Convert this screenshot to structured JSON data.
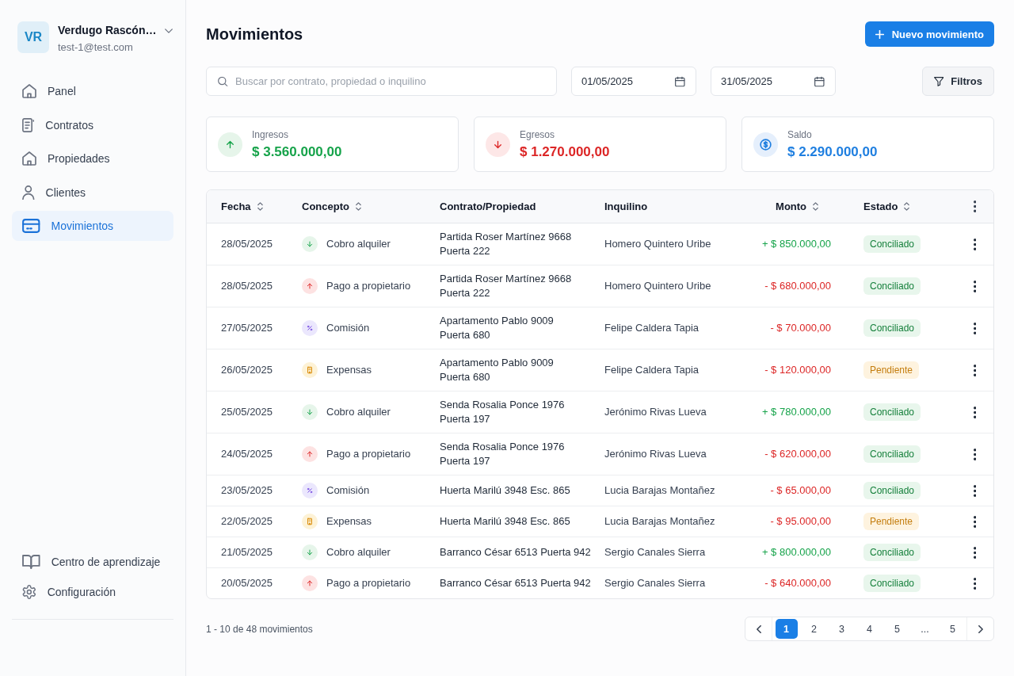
{
  "sidebar": {
    "user": {
      "initials": "VR",
      "name": "Verdugo Rascón…",
      "email": "test-1@test.com"
    },
    "nav_items": [
      {
        "label": "Panel",
        "selected": false
      },
      {
        "label": "Contratos",
        "selected": false
      },
      {
        "label": "Propiedades",
        "selected": false
      },
      {
        "label": "Clientes",
        "selected": false
      },
      {
        "label": "Movimientos",
        "selected": true
      }
    ],
    "footer_items": [
      {
        "label": "Centro de aprendizaje"
      },
      {
        "label": "Configuración"
      }
    ]
  },
  "header": {
    "title": "Movimientos",
    "primary_button": "Nuevo movimiento"
  },
  "filters": {
    "search": {
      "placeholder": "Buscar por contrato, propiedad o inquilino"
    },
    "date_from": {
      "value": "01/05/2025"
    },
    "date_to": {
      "value": "31/05/2025"
    },
    "filters_button": "Filtros"
  },
  "summary_cards": [
    {
      "kind": "income",
      "label": "Ingresos",
      "value": "$ 3.560.000,00"
    },
    {
      "kind": "expense",
      "label": "Egresos",
      "value": "$ 1.270.000,00"
    },
    {
      "kind": "balance",
      "label": "Saldo",
      "value": "$ 2.290.000,00"
    }
  ],
  "table": {
    "columns": [
      {
        "label": "Fecha",
        "sortable": true
      },
      {
        "label": "Concepto",
        "sortable": true
      },
      {
        "label": "Contrato/Propiedad",
        "sortable": false
      },
      {
        "label": "Inquilino",
        "sortable": false
      },
      {
        "label": "Monto",
        "sortable": true
      },
      {
        "label": "Estado",
        "sortable": true
      }
    ],
    "rows": [
      {
        "date": "28/05/2025",
        "concept": {
          "kind": "income",
          "label": "Cobro alquiler"
        },
        "property": "Partida Roser Martínez 9668\nPuerta 222",
        "tenant": "Homero Quintero Uribe",
        "amount": "+ $ 850.000,00",
        "status": {
          "kind": "reconciled",
          "label": "Conciliado"
        }
      },
      {
        "date": "28/05/2025",
        "concept": {
          "kind": "payout",
          "label": "Pago a propietario"
        },
        "property": "Partida Roser Martínez 9668\nPuerta 222",
        "tenant": "Homero Quintero Uribe",
        "amount": "- $ 680.000,00",
        "status": {
          "kind": "reconciled",
          "label": "Conciliado"
        }
      },
      {
        "date": "27/05/2025",
        "concept": {
          "kind": "commission",
          "label": "Comisión"
        },
        "property": "Apartamento Pablo 9009\nPuerta 680",
        "tenant": "Felipe Caldera Tapia",
        "amount": "- $ 70.000,00",
        "status": {
          "kind": "reconciled",
          "label": "Conciliado"
        }
      },
      {
        "date": "26/05/2025",
        "concept": {
          "kind": "expense",
          "label": "Expensas"
        },
        "property": "Apartamento Pablo 9009\nPuerta 680",
        "tenant": "Felipe Caldera Tapia",
        "amount": "- $ 120.000,00",
        "status": {
          "kind": "pending",
          "label": "Pendiente"
        }
      },
      {
        "date": "25/05/2025",
        "concept": {
          "kind": "income",
          "label": "Cobro alquiler"
        },
        "property": "Senda Rosalia Ponce 1976\nPuerta 197",
        "tenant": "Jerónimo Rivas Lueva",
        "amount": "+ $ 780.000,00",
        "status": {
          "kind": "reconciled",
          "label": "Conciliado"
        }
      },
      {
        "date": "24/05/2025",
        "concept": {
          "kind": "payout",
          "label": "Pago a propietario"
        },
        "property": "Senda Rosalia Ponce 1976\nPuerta 197",
        "tenant": "Jerónimo Rivas Lueva",
        "amount": "- $ 620.000,00",
        "status": {
          "kind": "reconciled",
          "label": "Conciliado"
        }
      },
      {
        "date": "23/05/2025",
        "concept": {
          "kind": "commission",
          "label": "Comisión"
        },
        "property": "Huerta Marilú 3948 Esc. 865",
        "tenant": "Lucia Barajas Montañez",
        "amount": "- $ 65.000,00",
        "status": {
          "kind": "reconciled",
          "label": "Conciliado"
        }
      },
      {
        "date": "22/05/2025",
        "concept": {
          "kind": "expense",
          "label": "Expensas"
        },
        "property": "Huerta Marilú 3948 Esc. 865",
        "tenant": "Lucia Barajas Montañez",
        "amount": "- $ 95.000,00",
        "status": {
          "kind": "pending",
          "label": "Pendiente"
        }
      },
      {
        "date": "21/05/2025",
        "concept": {
          "kind": "income",
          "label": "Cobro alquiler"
        },
        "property": "Barranco César 6513 Puerta 942",
        "tenant": "Sergio Canales Sierra",
        "amount": "+ $ 800.000,00",
        "status": {
          "kind": "reconciled",
          "label": "Conciliado"
        }
      },
      {
        "date": "20/05/2025",
        "concept": {
          "kind": "payout",
          "label": "Pago a propietario"
        },
        "property": "Barranco César 6513 Puerta 942",
        "tenant": "Sergio Canales Sierra",
        "amount": "- $ 640.000,00",
        "status": {
          "kind": "reconciled",
          "label": "Conciliado"
        }
      }
    ]
  },
  "pagination": {
    "summary": "1 - 10 de 48 movimientos",
    "pages": [
      {
        "label": "1",
        "selected": true
      },
      {
        "label": "2",
        "selected": false
      },
      {
        "label": "3",
        "selected": false
      },
      {
        "label": "4",
        "selected": false
      },
      {
        "label": "5",
        "selected": false
      },
      {
        "label": "...",
        "selected": false
      },
      {
        "label": "5",
        "selected": false
      }
    ]
  }
}
